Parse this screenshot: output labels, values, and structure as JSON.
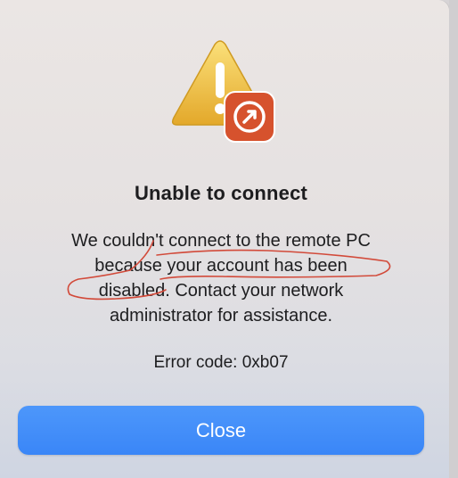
{
  "dialog": {
    "title": "Unable to connect",
    "message_lines": [
      "We couldn't connect to the remote PC",
      "because your account has been",
      "disabled. Contact your network",
      "administrator for assistance."
    ],
    "error_code": "Error code: 0xb07",
    "close_label": "Close"
  },
  "icons": {
    "warning": "warning-triangle-icon",
    "badge": "remote-desktop-icon"
  },
  "colors": {
    "accent": "#3a86f7",
    "warning_yellow": "#f2c43a",
    "badge_red": "#d6522d",
    "annotation": "#d24a3a"
  }
}
